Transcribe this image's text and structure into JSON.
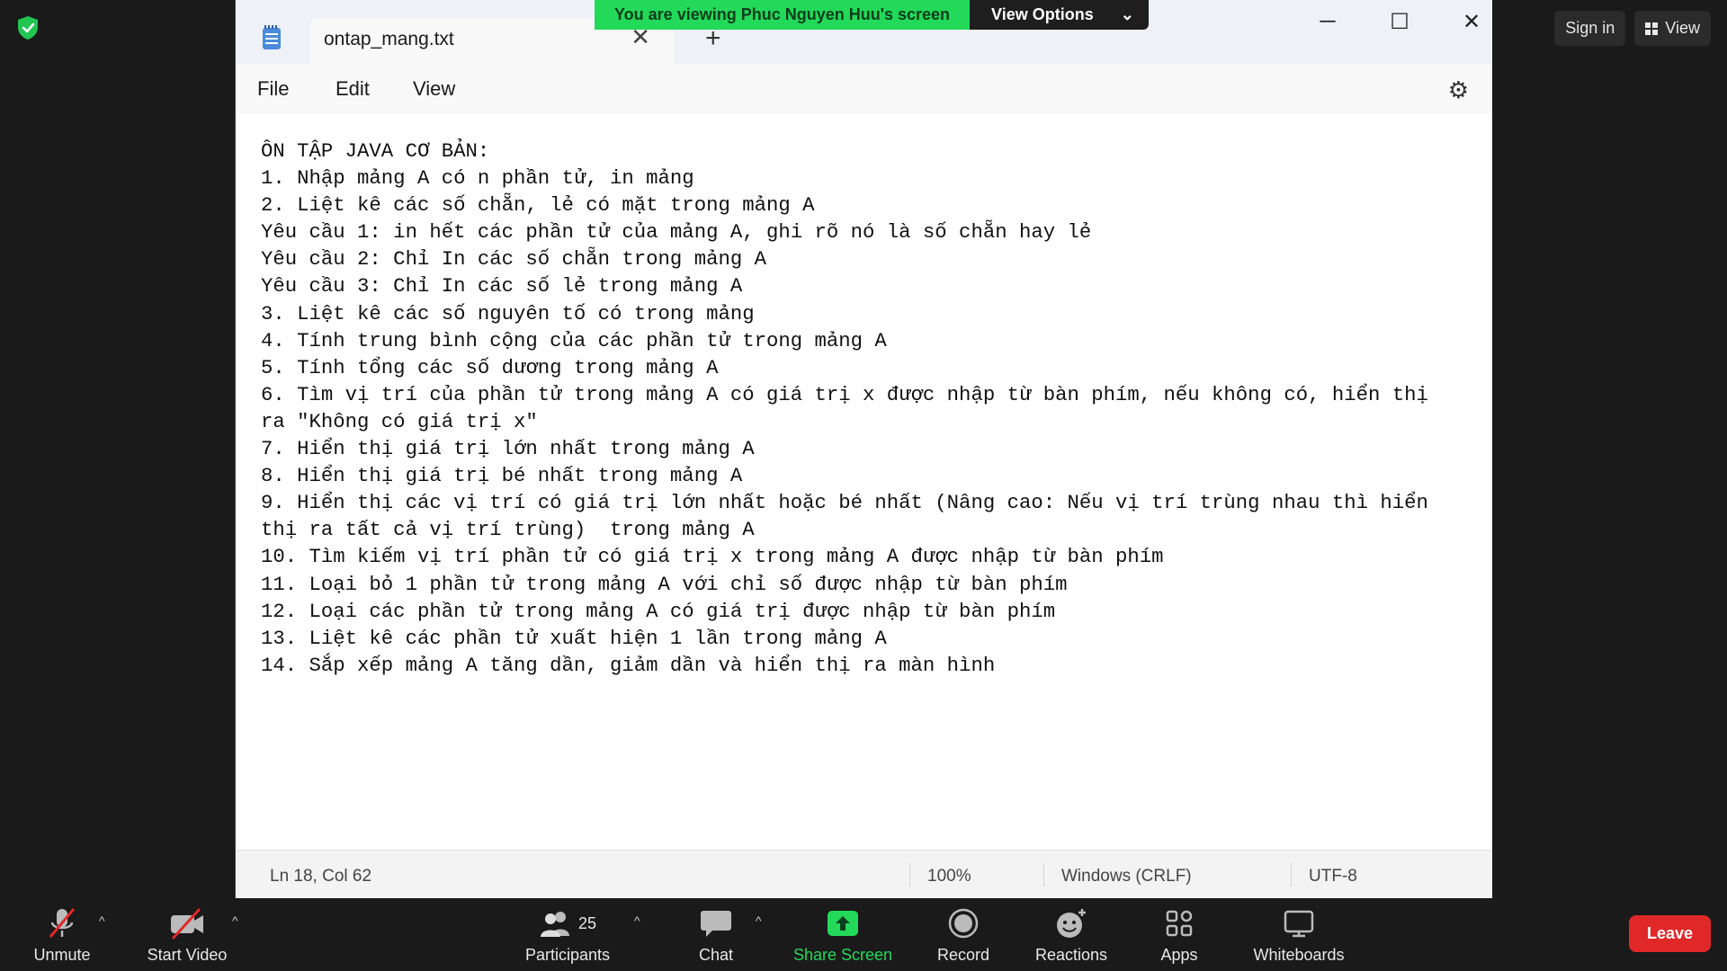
{
  "meeting": {
    "banner_text": "You are viewing Phuc Nguyen Huu's screen",
    "view_options_label": "View Options",
    "sign_in_label": "Sign in",
    "view_label": "View",
    "leave_label": "Leave"
  },
  "toolbar": {
    "unmute": "Unmute",
    "start_video": "Start Video",
    "participants": "Participants",
    "participant_count": "25",
    "chat": "Chat",
    "share_screen": "Share Screen",
    "record": "Record",
    "reactions": "Reactions",
    "apps": "Apps",
    "whiteboards": "Whiteboards"
  },
  "notepad": {
    "tab_title": "ontap_mang.txt",
    "menu": {
      "file": "File",
      "edit": "Edit",
      "view": "View"
    },
    "lines": [
      "ÔN TẬP JAVA CƠ BẢN:",
      "1. Nhập mảng A có n phần tử, in mảng",
      "2. Liệt kê các số chẵn, lẻ có mặt trong mảng A",
      "Yêu cầu 1: in hết các phần tử của mảng A, ghi rõ nó là số chẵn hay lẻ",
      "Yêu cầu 2: Chỉ In các số chẵn trong mảng A",
      "Yêu cầu 3: Chỉ In các số lẻ trong mảng A",
      "3. Liệt kê các số nguyên tố có trong mảng",
      "4. Tính trung bình cộng của các phần tử trong mảng A",
      "5. Tính tổng các số dương trong mảng A",
      "6. Tìm vị trí của phần tử trong mảng A có giá trị x được nhập từ bàn phím, nếu không có, hiển thị",
      "ra \"Không có giá trị x\"",
      "7. Hiển thị giá trị lớn nhất trong mảng A",
      "8. Hiển thị giá trị bé nhất trong mảng A",
      "9. Hiển thị các vị trí có giá trị lớn nhất hoặc bé nhất (Nâng cao: Nếu vị trí trùng nhau thì hiển",
      "thị ra tất cả vị trí trùng)  trong mảng A",
      "10. Tìm kiếm vị trí phần tử có giá trị x trong mảng A được nhập từ bàn phím",
      "11. Loại bỏ 1 phần tử trong mảng A với chỉ số được nhập từ bàn phím",
      "12. Loại các phần tử trong mảng A có giá trị được nhập từ bàn phím",
      "13. Liệt kê các phần tử xuất hiện 1 lần trong mảng A",
      "14. Sắp xếp mảng A tăng dần, giảm dần và hiển thị ra màn hình"
    ],
    "status": {
      "position": "Ln 18, Col 62",
      "zoom": "100%",
      "line_ending": "Windows (CRLF)",
      "encoding": "UTF-8"
    }
  },
  "colors": {
    "banner_green": "#23d959",
    "share_green": "#23d959",
    "leave_red": "#e02828",
    "muted_red": "#e02828"
  }
}
